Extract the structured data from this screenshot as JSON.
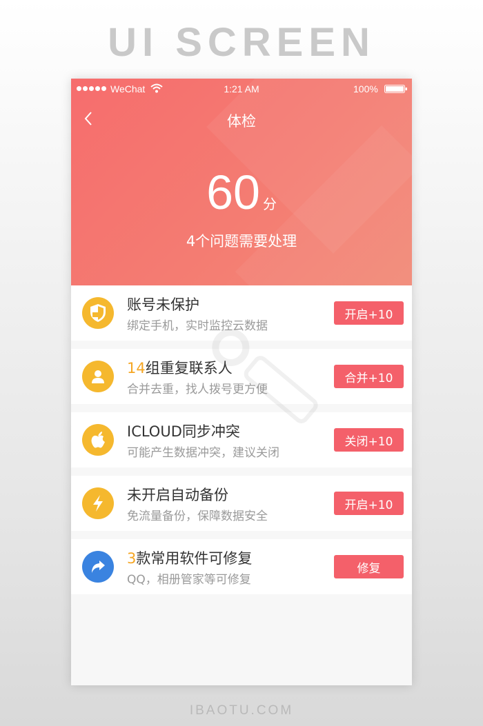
{
  "top_title": "UI SCREEN",
  "bottom_title": "IBAOTU.COM",
  "status_bar": {
    "carrier": "WeChat",
    "time": "1:21 AM",
    "battery": "100%"
  },
  "nav": {
    "title": "体检",
    "back_icon": "chevron-left-icon"
  },
  "summary": {
    "score": "60",
    "unit": "分",
    "issues": "4个问题需要处理"
  },
  "colors": {
    "header": "#f66d6d",
    "button": "#f4606a",
    "yellow_icon": "#f5b82e",
    "blue_icon": "#3a83e0",
    "highlight": "#f5a623"
  },
  "items": [
    {
      "icon": "shield-icon",
      "title_highlight": "",
      "title": "账号未保护",
      "subtitle": "绑定手机，实时监控云数据",
      "button": "开启+10"
    },
    {
      "icon": "person-icon",
      "title_highlight": "14",
      "title": "组重复联系人",
      "subtitle": "合并去重，找人拨号更方便",
      "button": "合并+10"
    },
    {
      "icon": "apple-icon",
      "title_highlight": "",
      "title": "ICLOUD同步冲突",
      "subtitle": "可能产生数据冲突，建议关闭",
      "button": "关闭+10"
    },
    {
      "icon": "lightning-icon",
      "title_highlight": "",
      "title": "未开启自动备份",
      "subtitle": "免流量备份，保障数据安全",
      "button": "开启+10"
    },
    {
      "icon": "share-arrow-icon",
      "title_highlight": "3",
      "title": "款常用软件可修复",
      "subtitle": "QQ，相册管家等可修复",
      "button": "修复"
    }
  ]
}
